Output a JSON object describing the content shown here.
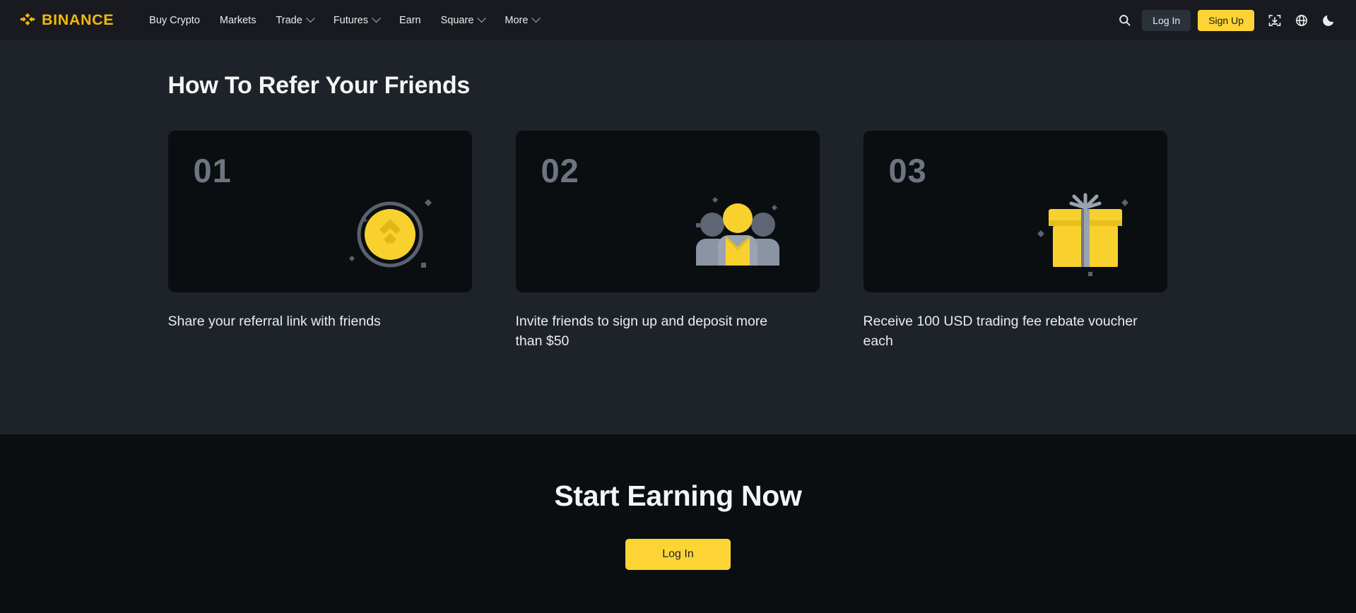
{
  "header": {
    "logo_text": "BINANCE",
    "logo_icon": "binance-diamond-logo",
    "nav": [
      {
        "label": "Buy Crypto",
        "has_caret": false
      },
      {
        "label": "Markets",
        "has_caret": false
      },
      {
        "label": "Trade",
        "has_caret": true
      },
      {
        "label": "Futures",
        "has_caret": true
      },
      {
        "label": "Earn",
        "has_caret": false
      },
      {
        "label": "Square",
        "has_caret": true
      },
      {
        "label": "More",
        "has_caret": true
      }
    ],
    "search_icon": "search-icon",
    "login_label": "Log In",
    "signup_label": "Sign Up",
    "download_icon": "download-app-icon",
    "language_icon": "globe-icon",
    "theme_icon": "moon-icon"
  },
  "refer_section": {
    "title": "How To Refer Your Friends",
    "cards": [
      {
        "number": "01",
        "art": "binance-coin-icon",
        "caption": "Share your referral link with friends"
      },
      {
        "number": "02",
        "art": "three-people-icon",
        "caption": "Invite friends to sign up and deposit more than $50"
      },
      {
        "number": "03",
        "art": "gift-box-icon",
        "caption": "Receive 100 USD trading fee rebate voucher each"
      }
    ]
  },
  "earn_section": {
    "title": "Start Earning Now",
    "cta_label": "Log In"
  },
  "colors": {
    "brand_yellow": "#f0b90b",
    "button_yellow": "#fcd535",
    "header_bg": "#181a20",
    "section_bg": "#1e2329",
    "card_bg": "#0b0e11",
    "text_primary": "#eaecef",
    "text_muted": "#6d7580",
    "icon_gray": "#6f7885"
  }
}
